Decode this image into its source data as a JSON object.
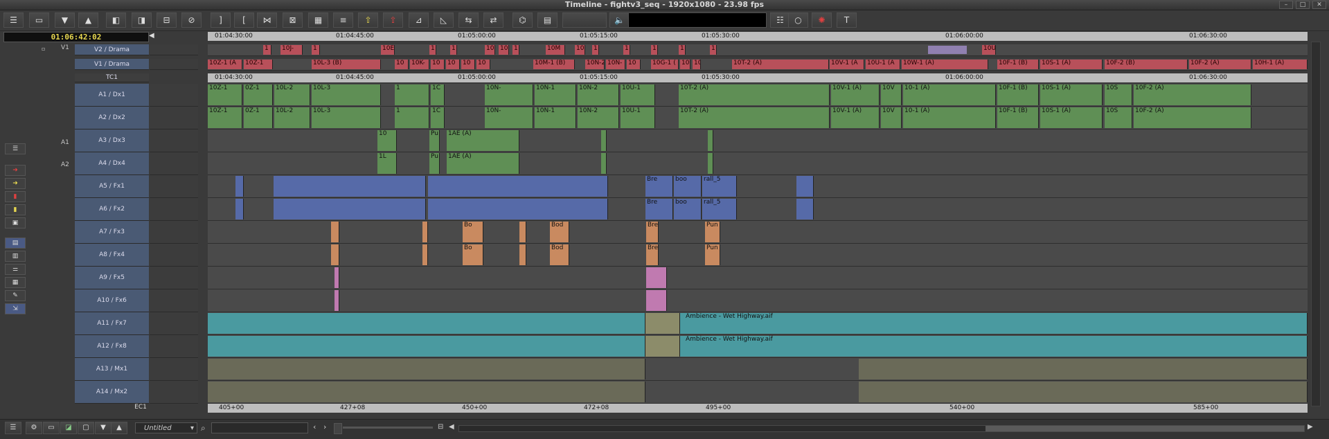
{
  "window": {
    "title": "Timeline - fightv3_seq - 1920x1080 - 23.98 fps"
  },
  "timecode": "01:06:42:02",
  "ruler": {
    "top_ticks": [
      "01:04:30:00",
      "01:04:45:00",
      "01:05:00:00",
      "01:05:15:00",
      "01:05:30:00",
      "01:06:00:00",
      "01:06:30:00"
    ],
    "tc1_ticks": [
      "01:04:30:00",
      "01:04:45:00",
      "01:05:00:00",
      "01:05:15:00",
      "01:05:30:00",
      "01:06:00:00",
      "01:06:30:00"
    ],
    "ec1_ticks": [
      "405+00",
      "427+08",
      "450+00",
      "472+08",
      "495+00",
      "540+00",
      "585+00"
    ],
    "tc1_label": "TC1",
    "ec1_label": "EC1"
  },
  "source_tracks": {
    "v1": "V1",
    "a1": "A1",
    "a2": "A2"
  },
  "tracks": [
    {
      "name": "V2 / Drama"
    },
    {
      "name": "V1 / Drama"
    },
    {
      "name": "A1 / Dx1"
    },
    {
      "name": "A2 / Dx2"
    },
    {
      "name": "A3 / Dx3"
    },
    {
      "name": "A4 / Dx4"
    },
    {
      "name": "A5 / Fx1"
    },
    {
      "name": "A6 / Fx2"
    },
    {
      "name": "A7 / Fx3"
    },
    {
      "name": "A8 / Fx4"
    },
    {
      "name": "A9 / Fx5"
    },
    {
      "name": "A10 / Fx6"
    },
    {
      "name": "A11 / Fx7"
    },
    {
      "name": "A12 / Fx8"
    },
    {
      "name": "A13 / Mx1"
    },
    {
      "name": "A14 / Mx2"
    }
  ],
  "clips": {
    "v2": [
      "1",
      "10J-",
      "1",
      "10E",
      "1",
      "1",
      "10",
      "10",
      "1",
      "10M",
      "10",
      "1",
      "1",
      "1",
      "1",
      "1",
      "10U"
    ],
    "v1": [
      "10Z-1 (A",
      "10Z-1",
      "10L-3 (B)",
      "10",
      "10K-",
      "10",
      "10",
      "10",
      "10",
      "10M-1 (B)",
      "10N-2",
      "10N-",
      "10",
      "10G-1 (",
      "10:",
      "10",
      "10T-2 (A)",
      "10V-1 (A",
      "10U-1 (A",
      "10W-1 (A)",
      "10F-1 (B)",
      "10S-1 (A)",
      "10F-2 (B)",
      "10F-2 (A)",
      "10H-1 (A)"
    ],
    "a1": [
      "10Z-1",
      "0Z-1",
      "10L-2",
      "10L-3",
      "1",
      "1C",
      "10N-",
      "10N-1",
      "10N-2",
      "10U-1",
      "10T-2 (A)",
      "10V-1 (A)",
      "10V",
      "10-1 (A)",
      "10F-1 (B)",
      "10S-1 (A)",
      "10S",
      "10F-2 (A)"
    ],
    "a2": [
      "10Z-1",
      "0Z-1",
      "10L-2",
      "10L-3",
      "1",
      "1C",
      "10N-",
      "10N-1",
      "10N-2",
      "10U-1",
      "10T-2 (A)",
      "10V-1 (A)",
      "10V",
      "10-1 (A)",
      "10F-1 (B)",
      "10S-1 (A)",
      "10S",
      "10F-2 (A)"
    ],
    "a3": [
      "10",
      "Pu",
      "1AE (A)"
    ],
    "a4": [
      "1L",
      "Pu",
      "1AE (A)"
    ],
    "a5": [
      "Bre",
      "boo",
      "rall_5"
    ],
    "a6": [
      "Bre",
      "boo",
      "rall_5"
    ],
    "a7": [
      "Bo",
      "Bod",
      "Bre",
      "Pun"
    ],
    "a8": [
      "Bo",
      "Bod",
      "Bre",
      "Pun"
    ],
    "a11": [
      "Ambience - Wet Highway.aif"
    ],
    "a12": [
      "Ambience - Wet Highway.aif"
    ]
  },
  "bottom": {
    "bin_name": "Untitled",
    "search_placeholder": ""
  },
  "colors": {
    "video_clip": "#b8505a",
    "dialog_clip": "#5f8f55",
    "fx_clip": "#566aa8",
    "fx3_clip": "#c98a60",
    "fx5_clip": "#c07ab0",
    "amb_clip": "#4a9aa0",
    "timecode_text": "#e8d850"
  }
}
